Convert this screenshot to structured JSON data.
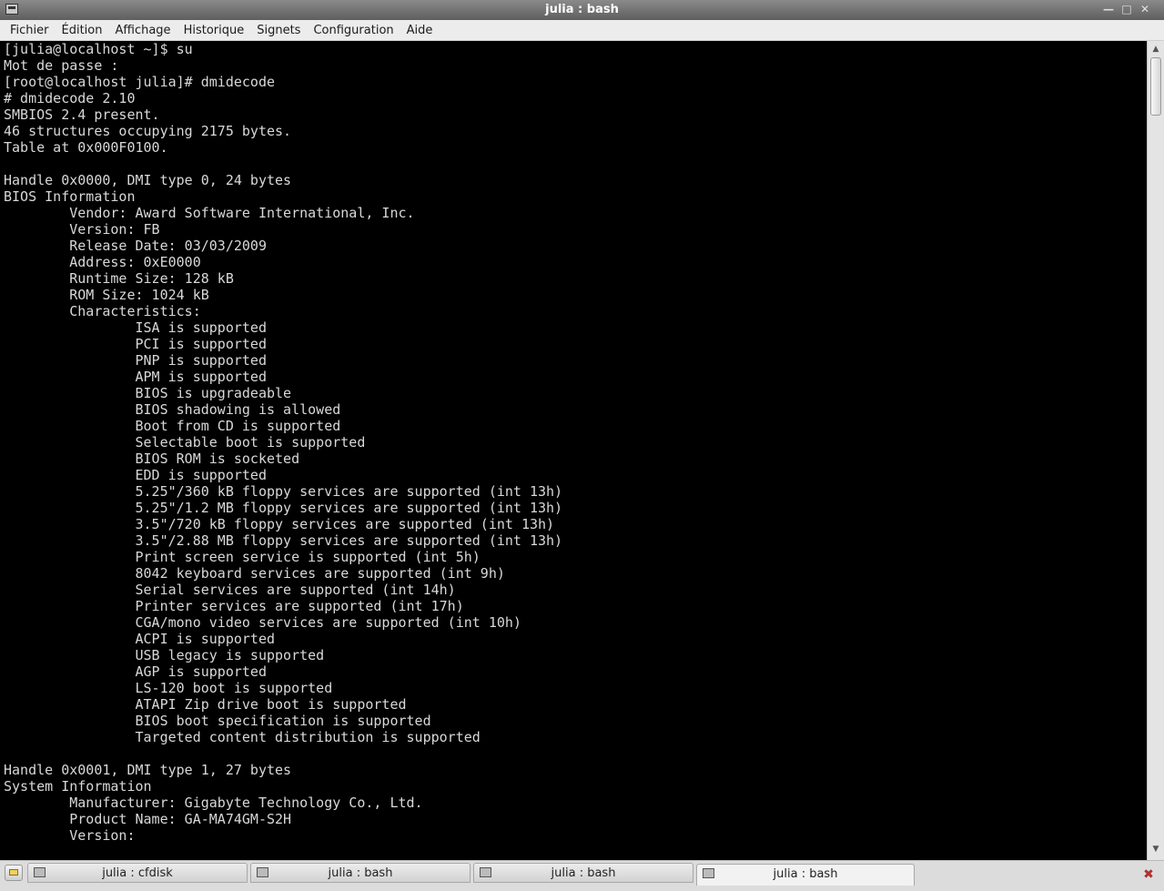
{
  "window": {
    "title": "julia : bash"
  },
  "menu": [
    "Fichier",
    "Édition",
    "Affichage",
    "Historique",
    "Signets",
    "Configuration",
    "Aide"
  ],
  "terminal": {
    "lines": [
      "[julia@localhost ~]$ su",
      "Mot de passe :",
      "[root@localhost julia]# dmidecode",
      "# dmidecode 2.10",
      "SMBIOS 2.4 present.",
      "46 structures occupying 2175 bytes.",
      "Table at 0x000F0100.",
      "",
      "Handle 0x0000, DMI type 0, 24 bytes",
      "BIOS Information",
      "        Vendor: Award Software International, Inc.",
      "        Version: FB",
      "        Release Date: 03/03/2009",
      "        Address: 0xE0000",
      "        Runtime Size: 128 kB",
      "        ROM Size: 1024 kB",
      "        Characteristics:",
      "                ISA is supported",
      "                PCI is supported",
      "                PNP is supported",
      "                APM is supported",
      "                BIOS is upgradeable",
      "                BIOS shadowing is allowed",
      "                Boot from CD is supported",
      "                Selectable boot is supported",
      "                BIOS ROM is socketed",
      "                EDD is supported",
      "                5.25\"/360 kB floppy services are supported (int 13h)",
      "                5.25\"/1.2 MB floppy services are supported (int 13h)",
      "                3.5\"/720 kB floppy services are supported (int 13h)",
      "                3.5\"/2.88 MB floppy services are supported (int 13h)",
      "                Print screen service is supported (int 5h)",
      "                8042 keyboard services are supported (int 9h)",
      "                Serial services are supported (int 14h)",
      "                Printer services are supported (int 17h)",
      "                CGA/mono video services are supported (int 10h)",
      "                ACPI is supported",
      "                USB legacy is supported",
      "                AGP is supported",
      "                LS-120 boot is supported",
      "                ATAPI Zip drive boot is supported",
      "                BIOS boot specification is supported",
      "                Targeted content distribution is supported",
      "",
      "Handle 0x0001, DMI type 1, 27 bytes",
      "System Information",
      "        Manufacturer: Gigabyte Technology Co., Ltd.",
      "        Product Name: GA-MA74GM-S2H",
      "        Version: "
    ]
  },
  "tabs": [
    {
      "label": "julia : cfdisk",
      "active": false
    },
    {
      "label": "julia : bash",
      "active": false
    },
    {
      "label": "julia : bash",
      "active": false
    },
    {
      "label": "julia : bash",
      "active": true
    }
  ]
}
